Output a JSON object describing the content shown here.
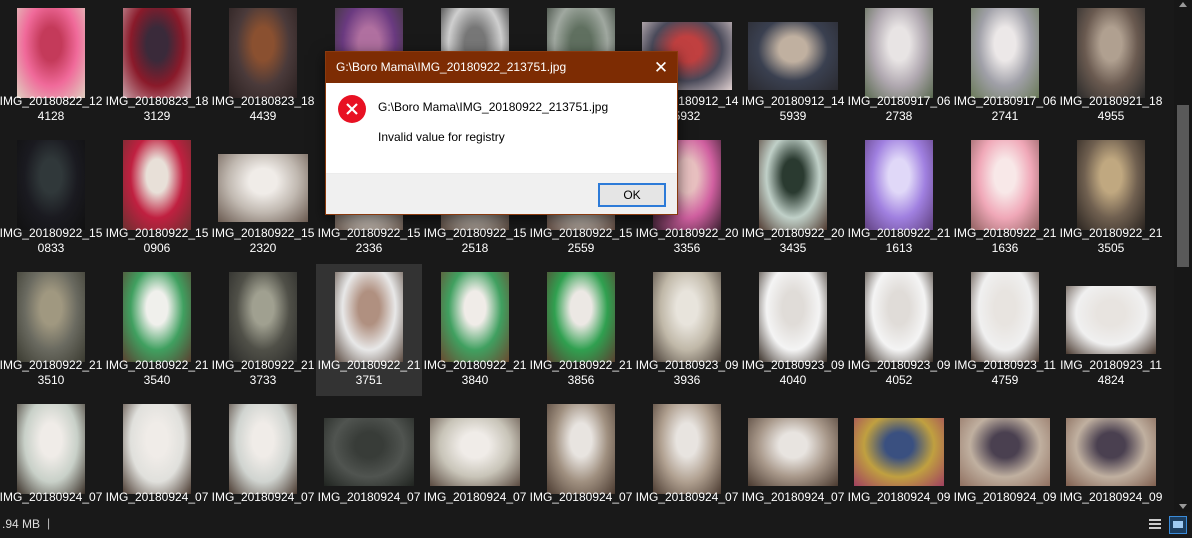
{
  "files": [
    {
      "name": "IMG_20180822_124128",
      "o": "p",
      "c": [
        "#f06a9a",
        "#c43a5a",
        "#e0d0c0"
      ]
    },
    {
      "name": "IMG_20180823_183129",
      "o": "p",
      "c": [
        "#8a1a2a",
        "#3a2a3a",
        "#c8a0a8"
      ]
    },
    {
      "name": "IMG_20180823_184439",
      "o": "p",
      "c": [
        "#4a3a3a",
        "#8a5030",
        "#2a2020"
      ]
    },
    {
      "name": "",
      "o": "p",
      "c": [
        "#6a3a80",
        "#b070a0",
        "#3a3a30"
      ]
    },
    {
      "name": "",
      "o": "p",
      "c": [
        "#cfcfcf",
        "#777777",
        "#222222"
      ]
    },
    {
      "name": "",
      "o": "p",
      "c": [
        "#a0a8a0",
        "#607060",
        "#303a30"
      ]
    },
    {
      "name": "IMG_20180912_145932",
      "o": "l",
      "c": [
        "#4a4a5a",
        "#c04040",
        "#e0d0d0"
      ]
    },
    {
      "name": "IMG_20180912_145939",
      "o": "l",
      "c": [
        "#3a4050",
        "#c0b0a0",
        "#2a2a30"
      ]
    },
    {
      "name": "IMG_20180917_062738",
      "o": "p",
      "c": [
        "#b0a8b0",
        "#e8e4e4",
        "#5a6a50"
      ]
    },
    {
      "name": "IMG_20180917_062741",
      "o": "p",
      "c": [
        "#a0a0a8",
        "#ece8e8",
        "#6a7a58"
      ]
    },
    {
      "name": "IMG_20180921_184955",
      "o": "p",
      "c": [
        "#6a5a50",
        "#b0a090",
        "#2a2a2a"
      ]
    },
    {
      "name": "IMG_20180922_150833",
      "o": "p",
      "c": [
        "#1a1a20",
        "#30383a",
        "#101010"
      ]
    },
    {
      "name": "IMG_20180922_150906",
      "o": "p",
      "c": [
        "#c02040",
        "#e8e0d8",
        "#6a3030"
      ]
    },
    {
      "name": "IMG_20180922_152320",
      "o": "l",
      "c": [
        "#c0b8b0",
        "#f0ece8",
        "#6a5a50"
      ]
    },
    {
      "name": "IMG_20180922_152336",
      "o": "p",
      "c": [
        "#c8c0b8",
        "#f0ece8",
        "#6a5a50"
      ]
    },
    {
      "name": "IMG_20180922_152518",
      "o": "p",
      "c": [
        "#b0a8a0",
        "#e8e4e0",
        "#5a4a40"
      ]
    },
    {
      "name": "IMG_20180922_152559",
      "o": "p",
      "c": [
        "#b8b0a8",
        "#ece8e4",
        "#604a40"
      ]
    },
    {
      "name": "IMG_20180922_203356",
      "o": "p",
      "c": [
        "#d060a0",
        "#e8c0c0",
        "#3a2030"
      ]
    },
    {
      "name": "IMG_20180922_203435",
      "o": "p",
      "c": [
        "#c0d0c8",
        "#2a3a30",
        "#503a30"
      ]
    },
    {
      "name": "IMG_20180922_211613",
      "o": "p",
      "c": [
        "#a080e0",
        "#e0d8f8",
        "#604080"
      ]
    },
    {
      "name": "IMG_20180922_211636",
      "o": "p",
      "c": [
        "#f0a8b8",
        "#f8e8e8",
        "#906060"
      ]
    },
    {
      "name": "IMG_20180922_213505",
      "o": "p",
      "c": [
        "#706050",
        "#c0a880",
        "#2a2420"
      ]
    },
    {
      "name": "IMG_20180922_213510",
      "o": "p",
      "c": [
        "#6a6a60",
        "#a09880",
        "#3a3a30"
      ]
    },
    {
      "name": "IMG_20180922_213540",
      "o": "p",
      "c": [
        "#40a060",
        "#f0f0ec",
        "#5a4030"
      ]
    },
    {
      "name": "IMG_20180922_213733",
      "o": "p",
      "c": [
        "#505048",
        "#a0a090",
        "#2a2a28"
      ]
    },
    {
      "name": "IMG_20180922_213751",
      "o": "p",
      "c": [
        "#e8e8e8",
        "#b09080",
        "#5a4a40"
      ]
    },
    {
      "name": "IMG_20180922_213840",
      "o": "p",
      "c": [
        "#40a060",
        "#f0ece8",
        "#6a4a30"
      ]
    },
    {
      "name": "IMG_20180922_213856",
      "o": "p",
      "c": [
        "#30a050",
        "#ece8e4",
        "#5a4030"
      ]
    },
    {
      "name": "IMG_20180923_093936",
      "o": "p",
      "c": [
        "#c0b8a8",
        "#e8e4dc",
        "#4a4038"
      ]
    },
    {
      "name": "IMG_20180923_094040",
      "o": "p",
      "c": [
        "#f4f4f4",
        "#e0dcd8",
        "#3a3028"
      ]
    },
    {
      "name": "IMG_20180923_094052",
      "o": "p",
      "c": [
        "#f4f4f4",
        "#e0dcd8",
        "#3a3028"
      ]
    },
    {
      "name": "IMG_20180923_114759",
      "o": "p",
      "c": [
        "#f0f0f0",
        "#e8e4e0",
        "#4a3a30"
      ]
    },
    {
      "name": "IMG_20180923_114824",
      "o": "l",
      "c": [
        "#f0f0f0",
        "#e8e4e0",
        "#4a3a30"
      ]
    },
    {
      "name": "IMG_20180924_07",
      "o": "p",
      "c": [
        "#c8d0c8",
        "#f0ece8",
        "#3a3028"
      ]
    },
    {
      "name": "IMG_20180924_07",
      "o": "p",
      "c": [
        "#e0e0dc",
        "#f0ece8",
        "#4a3a30"
      ]
    },
    {
      "name": "IMG_20180924_07",
      "o": "p",
      "c": [
        "#d0d4d0",
        "#f0ece8",
        "#4a3a30"
      ]
    },
    {
      "name": "IMG_20180924_07",
      "o": "l",
      "c": [
        "#505450",
        "#383c38",
        "#202420"
      ]
    },
    {
      "name": "IMG_20180924_07",
      "o": "l",
      "c": [
        "#c8c4b8",
        "#f0ece8",
        "#5a4a40"
      ]
    },
    {
      "name": "IMG_20180924_07",
      "o": "p",
      "c": [
        "#a09080",
        "#e8e4e0",
        "#4a3a30"
      ]
    },
    {
      "name": "IMG_20180924_07",
      "o": "p",
      "c": [
        "#b0a090",
        "#e8e4e0",
        "#4a3a30"
      ]
    },
    {
      "name": "IMG_20180924_07",
      "o": "l",
      "c": [
        "#a8988a",
        "#e8e4e0",
        "#4a3a30"
      ]
    },
    {
      "name": "IMG_20180924_09",
      "o": "l",
      "c": [
        "#c0a040",
        "#3a5080",
        "#a04060"
      ]
    },
    {
      "name": "IMG_20180924_09",
      "o": "l",
      "c": [
        "#c0b0a0",
        "#4a4050",
        "#907060"
      ]
    },
    {
      "name": "IMG_20180924_09",
      "o": "l",
      "c": [
        "#c0b0a0",
        "#4a4050",
        "#806050"
      ]
    }
  ],
  "selected_index": 25,
  "dialog": {
    "title": "G:\\Boro Mama\\IMG_20180922_213751.jpg",
    "path": "G:\\Boro Mama\\IMG_20180922_213751.jpg",
    "message": "Invalid value for registry",
    "ok_label": "OK",
    "close_glyph": "✕",
    "icon": "error-icon"
  },
  "statusbar": {
    "size_text": ".94 MB",
    "separator": "|"
  },
  "icons": {
    "details_view": "details-view-icon",
    "large_icons_view": "large-icons-view-icon"
  },
  "colors": {
    "background": "#191919",
    "dialog_titlebar": "#7d2c03",
    "error_red": "#e81123",
    "ok_border": "#2d7bd8"
  }
}
